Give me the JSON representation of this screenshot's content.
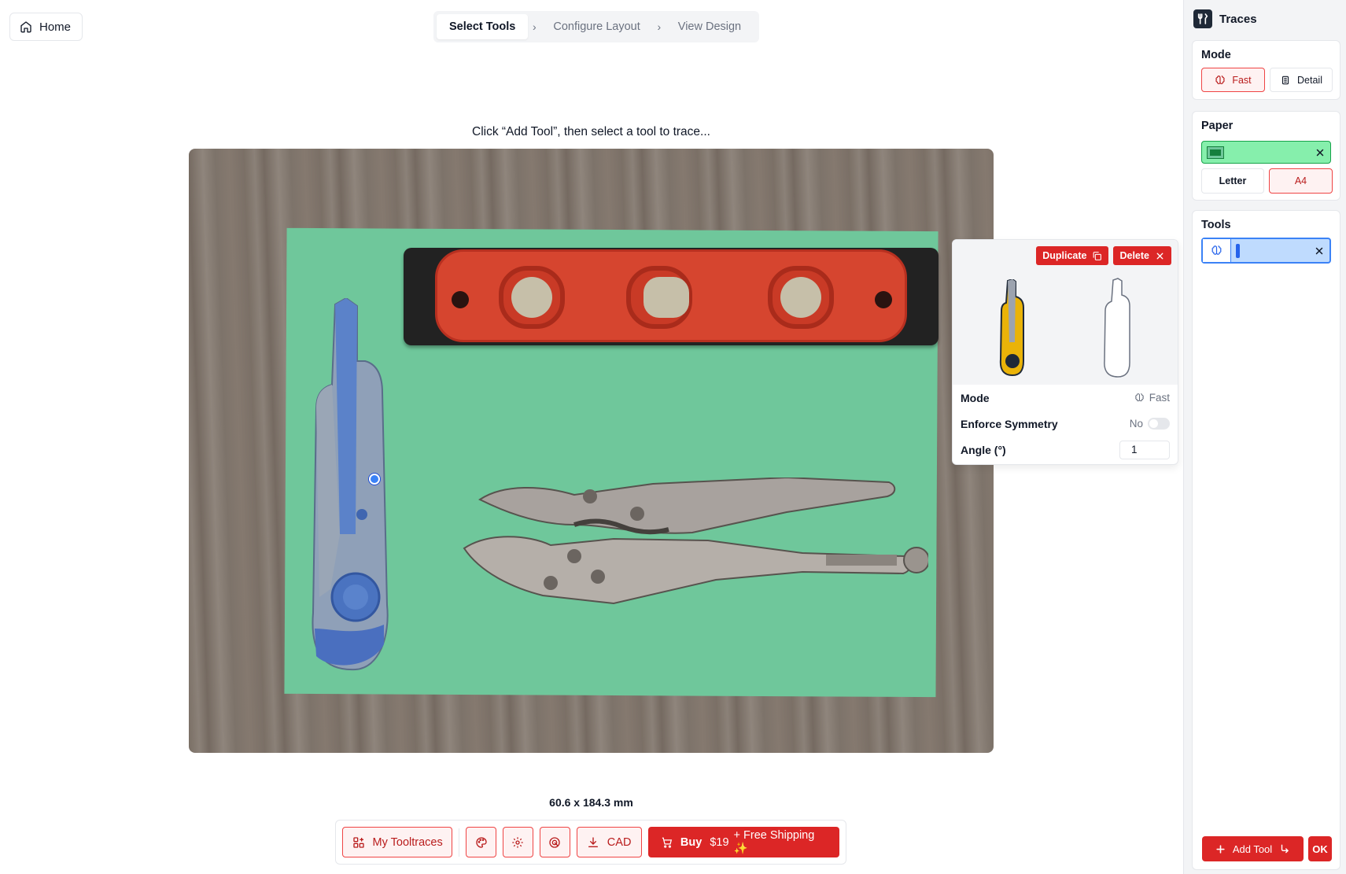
{
  "header": {
    "home_label": "Home",
    "steps": [
      "Select Tools",
      "Configure Layout",
      "View Design"
    ],
    "active_step": "Select Tools"
  },
  "canvas": {
    "instruction": "Click “Add Tool”, then select a tool to trace..."
  },
  "popover": {
    "duplicate_label": "Duplicate",
    "delete_label": "Delete",
    "mode_label": "Mode",
    "mode_value": "Fast",
    "symmetry_label": "Enforce Symmetry",
    "symmetry_value": "No",
    "angle_label": "Angle (°)",
    "angle_value": "1"
  },
  "footer": {
    "dimensions": "60.6 x 184.3 mm",
    "my_tooltraces_label": "My Tooltraces",
    "cad_label": "CAD",
    "buy_label": "Buy",
    "buy_price": "$19",
    "buy_shipping": "+ Free Shipping ✨"
  },
  "sidebar": {
    "title": "Traces",
    "mode_title": "Mode",
    "mode_fast": "Fast",
    "mode_detail": "Detail",
    "paper_title": "Paper",
    "paper_letter": "Letter",
    "paper_a4": "A4",
    "selected_paper": "A4",
    "tools_title": "Tools",
    "add_tool_label": "Add Tool",
    "ok_label": "OK"
  },
  "colors": {
    "accent": "#dc2626",
    "accent_light": "#fef2f2",
    "paper_green": "#6fc79b",
    "selection_blue": "#3b82f6"
  }
}
